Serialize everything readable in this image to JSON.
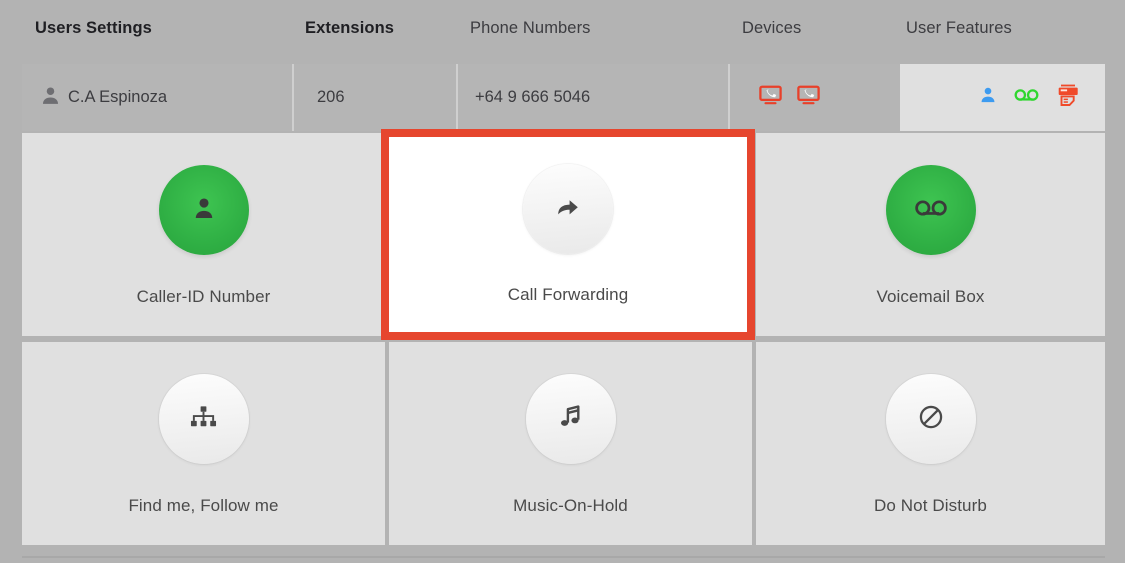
{
  "colors": {
    "page_background": "#b3b3b3",
    "card_background": "#e0e0e0",
    "highlight_border": "#e6462e",
    "green_circle": "#2faf44",
    "grey_circle": "#f2f2f2",
    "row_cell": "#b5b5b5",
    "text": "#3c3c40",
    "device_icon_red": "#e8402a",
    "feature_icon_blue": "#3d9bf0",
    "feature_icon_green": "#2fd62f",
    "feature_icon_fax": "#f04a2a"
  },
  "nav": {
    "tabs": [
      {
        "label": "Users Settings",
        "active": true
      },
      {
        "label": "Extensions",
        "active": true
      },
      {
        "label": "Phone Numbers",
        "active": false
      },
      {
        "label": "Devices",
        "active": false
      },
      {
        "label": "User Features",
        "active": false
      }
    ]
  },
  "user_row": {
    "avatar_icon": "user-icon",
    "name": "C.A Espinoza",
    "extension": "206",
    "phone_number": "+64 9 666 5046",
    "devices": [
      {
        "icon": "desk-phone-icon"
      },
      {
        "icon": "desk-phone-icon"
      }
    ],
    "features": [
      {
        "icon": "user-profile-icon"
      },
      {
        "icon": "voicemail-icon"
      },
      {
        "icon": "fax-icon"
      }
    ]
  },
  "feature_cards": [
    {
      "label": "Caller-ID Number",
      "icon": "user-icon",
      "circle_style": "green",
      "highlighted": false
    },
    {
      "label": "Call Forwarding",
      "icon": "forward-arrow-icon",
      "circle_style": "grey",
      "highlighted": true
    },
    {
      "label": "Voicemail Box",
      "icon": "voicemail-icon",
      "circle_style": "green",
      "highlighted": false
    },
    {
      "label": "Find me, Follow me",
      "icon": "sitemap-icon",
      "circle_style": "grey",
      "highlighted": false
    },
    {
      "label": "Music-On-Hold",
      "icon": "music-note-icon",
      "circle_style": "grey",
      "highlighted": false
    },
    {
      "label": "Do Not Disturb",
      "icon": "do-not-disturb-icon",
      "circle_style": "grey",
      "highlighted": false
    }
  ]
}
